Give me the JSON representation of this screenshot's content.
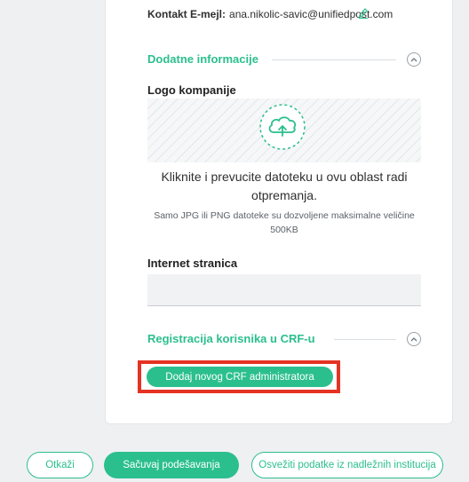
{
  "contact": {
    "label": "Kontakt E-mejl:",
    "email": "ana.nikolic-savic@unifiedpost.com"
  },
  "sections": {
    "additional_info": {
      "title": "Dodatne informacije"
    },
    "crf_registration": {
      "title": "Registracija korisnika u CRF-u"
    }
  },
  "logo": {
    "label": "Logo kompanije",
    "dropzone_text": "Kliknite i prevucite datoteku u ovu oblast radi otpremanja.",
    "dropzone_note": "Samo JPG ili PNG datoteke su dozvoljene maksimalne veličine 500KB"
  },
  "website": {
    "label": "Internet stranica",
    "value": ""
  },
  "add_admin_button": "Dodaj novog CRF administratora",
  "footer": {
    "cancel": "Otkaži",
    "save": "Sačuvaj podešavanja",
    "refresh": "Osvežiti podatke iz nadležnih institucija"
  },
  "colors": {
    "accent": "#2bbf8e",
    "highlight": "#e53223"
  },
  "icons": {
    "edit": "pencil-icon",
    "collapse": "chevron-up-icon",
    "upload": "cloud-upload-icon"
  }
}
